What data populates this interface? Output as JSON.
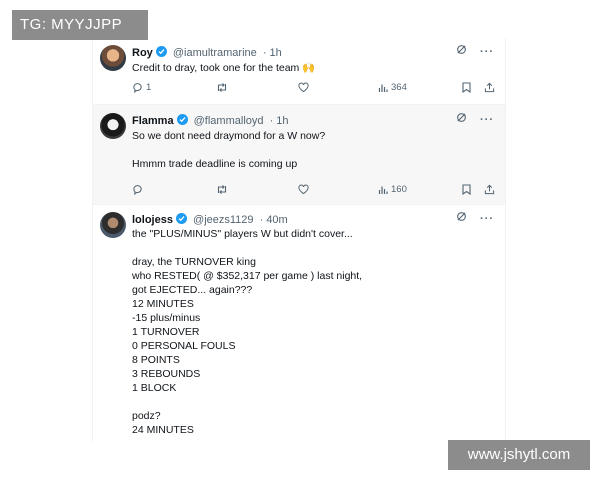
{
  "watermarks": {
    "top_left": "TG: MYYJJPP",
    "bottom_right": "www.jshytl.com"
  },
  "colors": {
    "verified": "#1d9bf0",
    "muted": "#536471",
    "text": "#0f1419",
    "highlight_bg": "#f7f7f7"
  },
  "tweets": [
    {
      "author": "Roy",
      "handle": "@iamultramarine",
      "time": "· 1h",
      "text": "Credit to dray, took one for the team 🙌",
      "replies": "1",
      "retweets": "",
      "likes": "",
      "views": "364",
      "avatar_icon": "avatar-roy"
    },
    {
      "author": "Flamma",
      "handle": "@flammalloyd",
      "time": "· 1h",
      "text": "So we dont need draymond for a W now?\n\nHmmm trade deadline is coming up",
      "replies": "",
      "retweets": "",
      "likes": "",
      "views": "160",
      "avatar_icon": "avatar-flamma"
    },
    {
      "author": "lolojess",
      "handle": "@jeezs1129",
      "time": "· 40m",
      "text": "the \"PLUS/MINUS\" players W but didn't cover...\n\ndray, the TURNOVER king\nwho RESTED( @ $352,317 per game ) last night,\ngot EJECTED... again???\n12 MINUTES\n-15 plus/minus\n1 TURNOVER\n0 PERSONAL FOULS\n8 POINTS\n3 REBOUNDS\n1 BLOCK\n\npodz?\n24 MINUTES",
      "avatar_icon": "avatar-lolo"
    }
  ]
}
